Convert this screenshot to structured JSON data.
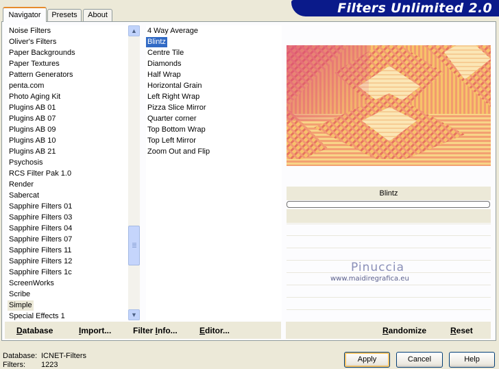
{
  "banner": {
    "title": "Filters Unlimited 2.0"
  },
  "tabs": [
    {
      "label": "Navigator",
      "active": true
    },
    {
      "label": "Presets",
      "active": false
    },
    {
      "label": "About",
      "active": false
    }
  ],
  "categories": {
    "items": [
      "Noise Filters",
      "Oliver's Filters",
      "Paper Backgrounds",
      "Paper Textures",
      "Pattern Generators",
      "penta.com",
      "Photo Aging Kit",
      "Plugins AB 01",
      "Plugins AB 07",
      "Plugins AB 09",
      "Plugins AB 10",
      "Plugins AB 21",
      "Psychosis",
      "RCS Filter Pak 1.0",
      "Render",
      "Sabercat",
      "Sapphire Filters 01",
      "Sapphire Filters 03",
      "Sapphire Filters 04",
      "Sapphire Filters 07",
      "Sapphire Filters 11",
      "Sapphire Filters 12",
      "Sapphire Filters 1c",
      "ScreenWorks",
      "Scribe",
      "Simple",
      "Special Effects 1"
    ],
    "selected_index": 25
  },
  "filters": {
    "items": [
      "4 Way Average",
      "Blintz",
      "Centre Tile",
      "Diamonds",
      "Half Wrap",
      "Horizontal Grain",
      "Left Right Wrap",
      "Pizza Slice Mirror",
      "Quarter corner",
      "Top Bottom Wrap",
      "Top Left Mirror",
      "Zoom Out and Flip"
    ],
    "selected_index": 1
  },
  "preview": {
    "filter_name": "Blintz",
    "progress": 0
  },
  "watermark": {
    "name": "Pinuccia",
    "url": "www.maidiregrafica.eu"
  },
  "left_buttons": [
    {
      "label": "Database",
      "accel": "D"
    },
    {
      "label": "Import...",
      "accel": "I"
    },
    {
      "label": "Filter Info...",
      "accel": "I"
    },
    {
      "label": "Editor...",
      "accel": "E"
    }
  ],
  "right_buttons": [
    {
      "label": "Randomize",
      "accel": "R"
    },
    {
      "label": "Reset",
      "accel": "R"
    }
  ],
  "status": {
    "database_label": "Database:",
    "database_value": "ICNET-Filters",
    "filters_label": "Filters:",
    "filters_value": "1223"
  },
  "dialog_buttons": {
    "apply": "Apply",
    "cancel": "Cancel",
    "help": "Help"
  },
  "colors": {
    "banner": "#0a1a8a",
    "selection": "#316ac5",
    "tab_accent": "#e68b2c"
  }
}
